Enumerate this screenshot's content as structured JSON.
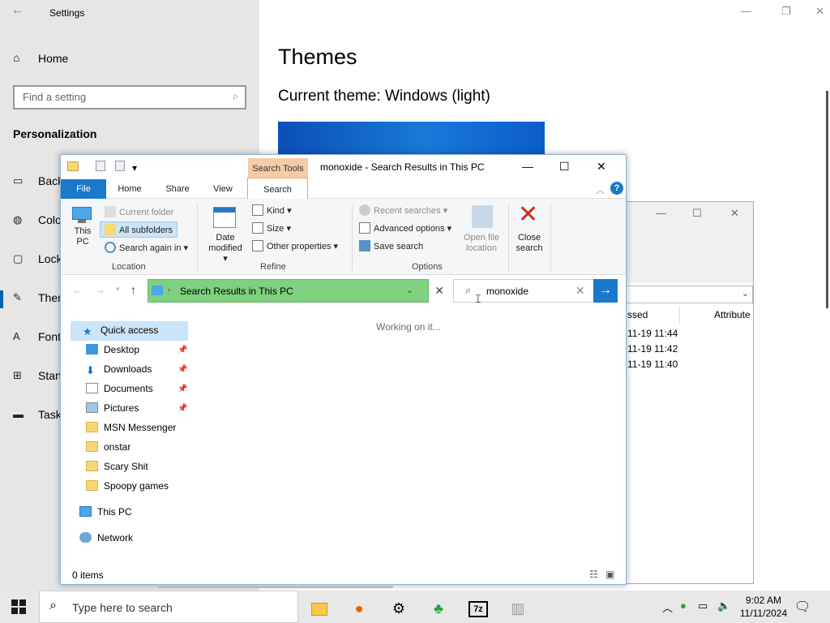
{
  "settings": {
    "title": "Settings",
    "home": "Home",
    "search_placeholder": "Find a setting",
    "category": "Personalization",
    "nav": [
      {
        "label": "Back",
        "icon": "picture-icon"
      },
      {
        "label": "Colo",
        "icon": "palette-icon"
      },
      {
        "label": "Lock",
        "icon": "lock-screen-icon"
      },
      {
        "label": "Ther",
        "icon": "brush-icon"
      },
      {
        "label": "Font",
        "icon": "font-icon"
      },
      {
        "label": "Start",
        "icon": "start-icon"
      },
      {
        "label": "Task",
        "icon": "taskbar-icon"
      }
    ],
    "main_title": "Themes",
    "current_theme": "Current theme: Windows (light)"
  },
  "bg_explorer": {
    "col_accessed": "ssed",
    "col_attributes": "Attribute",
    "rows": [
      "11-19 11:44",
      "11-19 11:42",
      "11-19 11:40"
    ]
  },
  "explorer": {
    "title": "monoxide - Search Results in This PC",
    "context_tab": "Search Tools",
    "tabs": {
      "file": "File",
      "home": "Home",
      "share": "Share",
      "view": "View",
      "search": "Search"
    },
    "ribbon": {
      "this_pc": "This PC",
      "current_folder": "Current folder",
      "all_subfolders": "All subfolders",
      "search_again": "Search again in",
      "date_modified": "Date modified",
      "kind": "Kind",
      "size": "Size",
      "other_properties": "Other properties",
      "recent_searches": "Recent searches",
      "advanced_options": "Advanced options",
      "save_search": "Save search",
      "open_file_location": "Open file location",
      "close_search": "Close search",
      "groups": {
        "location": "Location",
        "refine": "Refine",
        "options": "Options"
      }
    },
    "address": "Search Results in This PC",
    "search_query": "monoxide",
    "working": "Working on it...",
    "tree": {
      "quick_access": "Quick access",
      "pinned": [
        "Desktop",
        "Downloads",
        "Documents",
        "Pictures"
      ],
      "folders": [
        "MSN Messenger",
        "onstar",
        "Scary Shit",
        "Spoopy games"
      ],
      "this_pc": "This PC",
      "network": "Network"
    },
    "status": "0 items"
  },
  "taskbar": {
    "search_placeholder": "Type here to search",
    "time": "9:02 AM",
    "date": "11/11/2024"
  }
}
